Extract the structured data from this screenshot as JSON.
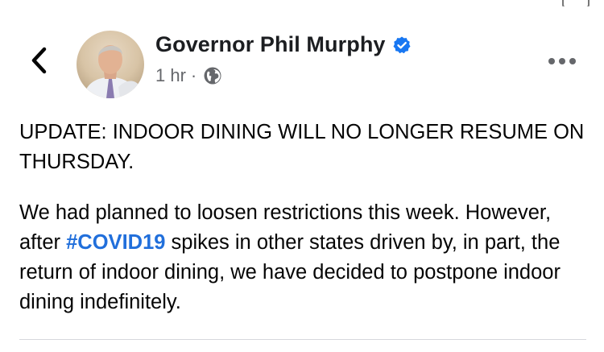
{
  "post": {
    "author": "Governor Phil Murphy",
    "timestamp": "1 hr",
    "separator": "·",
    "paragraph1": "UPDATE: INDOOR DINING WILL NO LONGER RESUME ON THURSDAY.",
    "paragraph2_before": "We had planned to loosen restrictions this week. However, after ",
    "hashtag": "#COVID19",
    "paragraph2_after": " spikes in other states driven by, in part, the return of indoor dining, we have decided to postpone indoor dining indefinitely."
  },
  "icons": {
    "back": "chevron-left-icon",
    "verified": "verified-badge-icon",
    "audience": "globe-icon",
    "more": "more-horizontal-icon"
  },
  "colors": {
    "hashtag": "#216fdb",
    "verified": "#1877f2",
    "meta": "#65676b"
  }
}
